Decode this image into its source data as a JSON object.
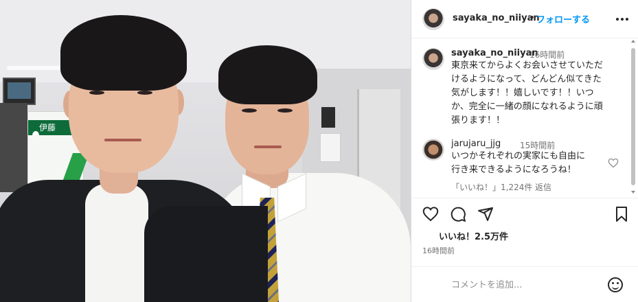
{
  "photo": {
    "sign_text": "伊藤"
  },
  "header": {
    "username": "sayaka_no_niiyan",
    "separator": "•",
    "follow_label": "フォローする",
    "more_icon": "more-horizontal-icon"
  },
  "caption": {
    "username": "sayaka_no_niiyan",
    "time": "16時間前",
    "text_lines": [
      "東京来てからよくお会いさせていただ",
      "けるようになって、どんどん似てきた",
      "気がします！！嬉しいです！！いつ",
      "か、完全に一緒の顔になれるように頑",
      "張ります！！"
    ]
  },
  "comment": {
    "username": "jarujaru_jjg",
    "time": "15時間前",
    "text_lines": [
      "いつかそれぞれの実家にも自由に",
      "行き来できるようになろうね！"
    ],
    "likes_label": "「いいね！」1,224件",
    "reply_label": "返信",
    "like_icon": "heart-outline-icon"
  },
  "actions": {
    "like_icon": "heart-icon",
    "comment_icon": "comment-icon",
    "share_icon": "send-icon",
    "save_icon": "bookmark-icon"
  },
  "post": {
    "likes": "いいね！2.5万件",
    "time": "16時間前"
  },
  "add_comment": {
    "placeholder": "コメントを追加...",
    "emoji_icon": "emoji-icon"
  }
}
